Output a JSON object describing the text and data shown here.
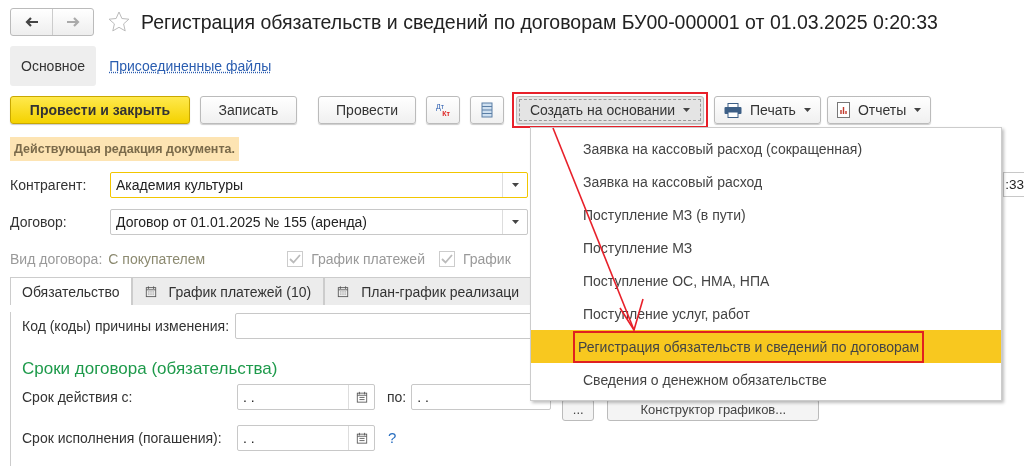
{
  "title": "Регистрация обязательств и сведений по договорам БУ00-000001 от 01.03.2025 0:20:33",
  "sections": [
    {
      "label": "Основное",
      "selected": true
    },
    {
      "label": "Присоединенные файлы",
      "selected": false
    }
  ],
  "toolbar": [
    {
      "kind": "primary",
      "label": "Провести и закрыть"
    },
    {
      "kind": "plain",
      "label": "Записать"
    },
    {
      "kind": "plain",
      "label": "Провести"
    },
    {
      "kind": "dtkt",
      "top": "Дт",
      "bottom": "Кт"
    },
    {
      "kind": "list"
    },
    {
      "kind": "dropdown",
      "label": "Создать на основании",
      "open": true,
      "annotated": true
    },
    {
      "kind": "print",
      "label": "Печать"
    },
    {
      "kind": "report",
      "label": "Отчеты"
    }
  ],
  "notice": "Действующая редакция документа.",
  "contractor": {
    "label": "Контрагент:",
    "value": "Академия культуры",
    "focused": true,
    "side_value": ":33"
  },
  "contract": {
    "label": "Договор:",
    "value": "Договор от 01.01.2025 № 155 (аренда)",
    "focused": false
  },
  "contract_type": {
    "label": "Вид договора:",
    "value": "С покупателем"
  },
  "checkboxes": [
    {
      "label": "График платежей",
      "checked": true,
      "disabled": true
    },
    {
      "label": "График",
      "checked": true,
      "disabled": true
    }
  ],
  "tabs": [
    {
      "label": "Обязательство",
      "selected": true,
      "kind": "plain"
    },
    {
      "label": "График платежей (10)",
      "selected": false,
      "kind": "schedule"
    },
    {
      "label": "План-график реализаци",
      "selected": false,
      "kind": "schedule"
    }
  ],
  "reason": {
    "label": "Код (коды) причины изменения:"
  },
  "section_title": "Сроки договора (обязательства)",
  "term": {
    "label": "Срок действия с:",
    "value": ". .",
    "to_label": "по:",
    "to_value": ". .",
    "more": "...",
    "constructor": "Конструктор графиков..."
  },
  "execution": {
    "label": "Срок исполнения (погашения):",
    "value": ". .",
    "help": "?"
  },
  "menu": [
    {
      "label": "Заявка на кассовый расход (сокращенная)",
      "selected": false,
      "annotated": false
    },
    {
      "label": "Заявка на кассовый расход",
      "selected": false,
      "annotated": false
    },
    {
      "label": "Поступление МЗ (в пути)",
      "selected": false,
      "annotated": false
    },
    {
      "label": "Поступление МЗ",
      "selected": false,
      "annotated": false
    },
    {
      "label": "Поступление ОС, НМА, НПА",
      "selected": false,
      "annotated": false
    },
    {
      "label": "Поступление услуг, работ",
      "selected": false,
      "annotated": false
    },
    {
      "label": "Регистрация обязательств и сведений по договорам",
      "selected": true,
      "annotated": true
    },
    {
      "label": "Сведения о денежном обязательстве",
      "selected": false,
      "annotated": false
    }
  ]
}
